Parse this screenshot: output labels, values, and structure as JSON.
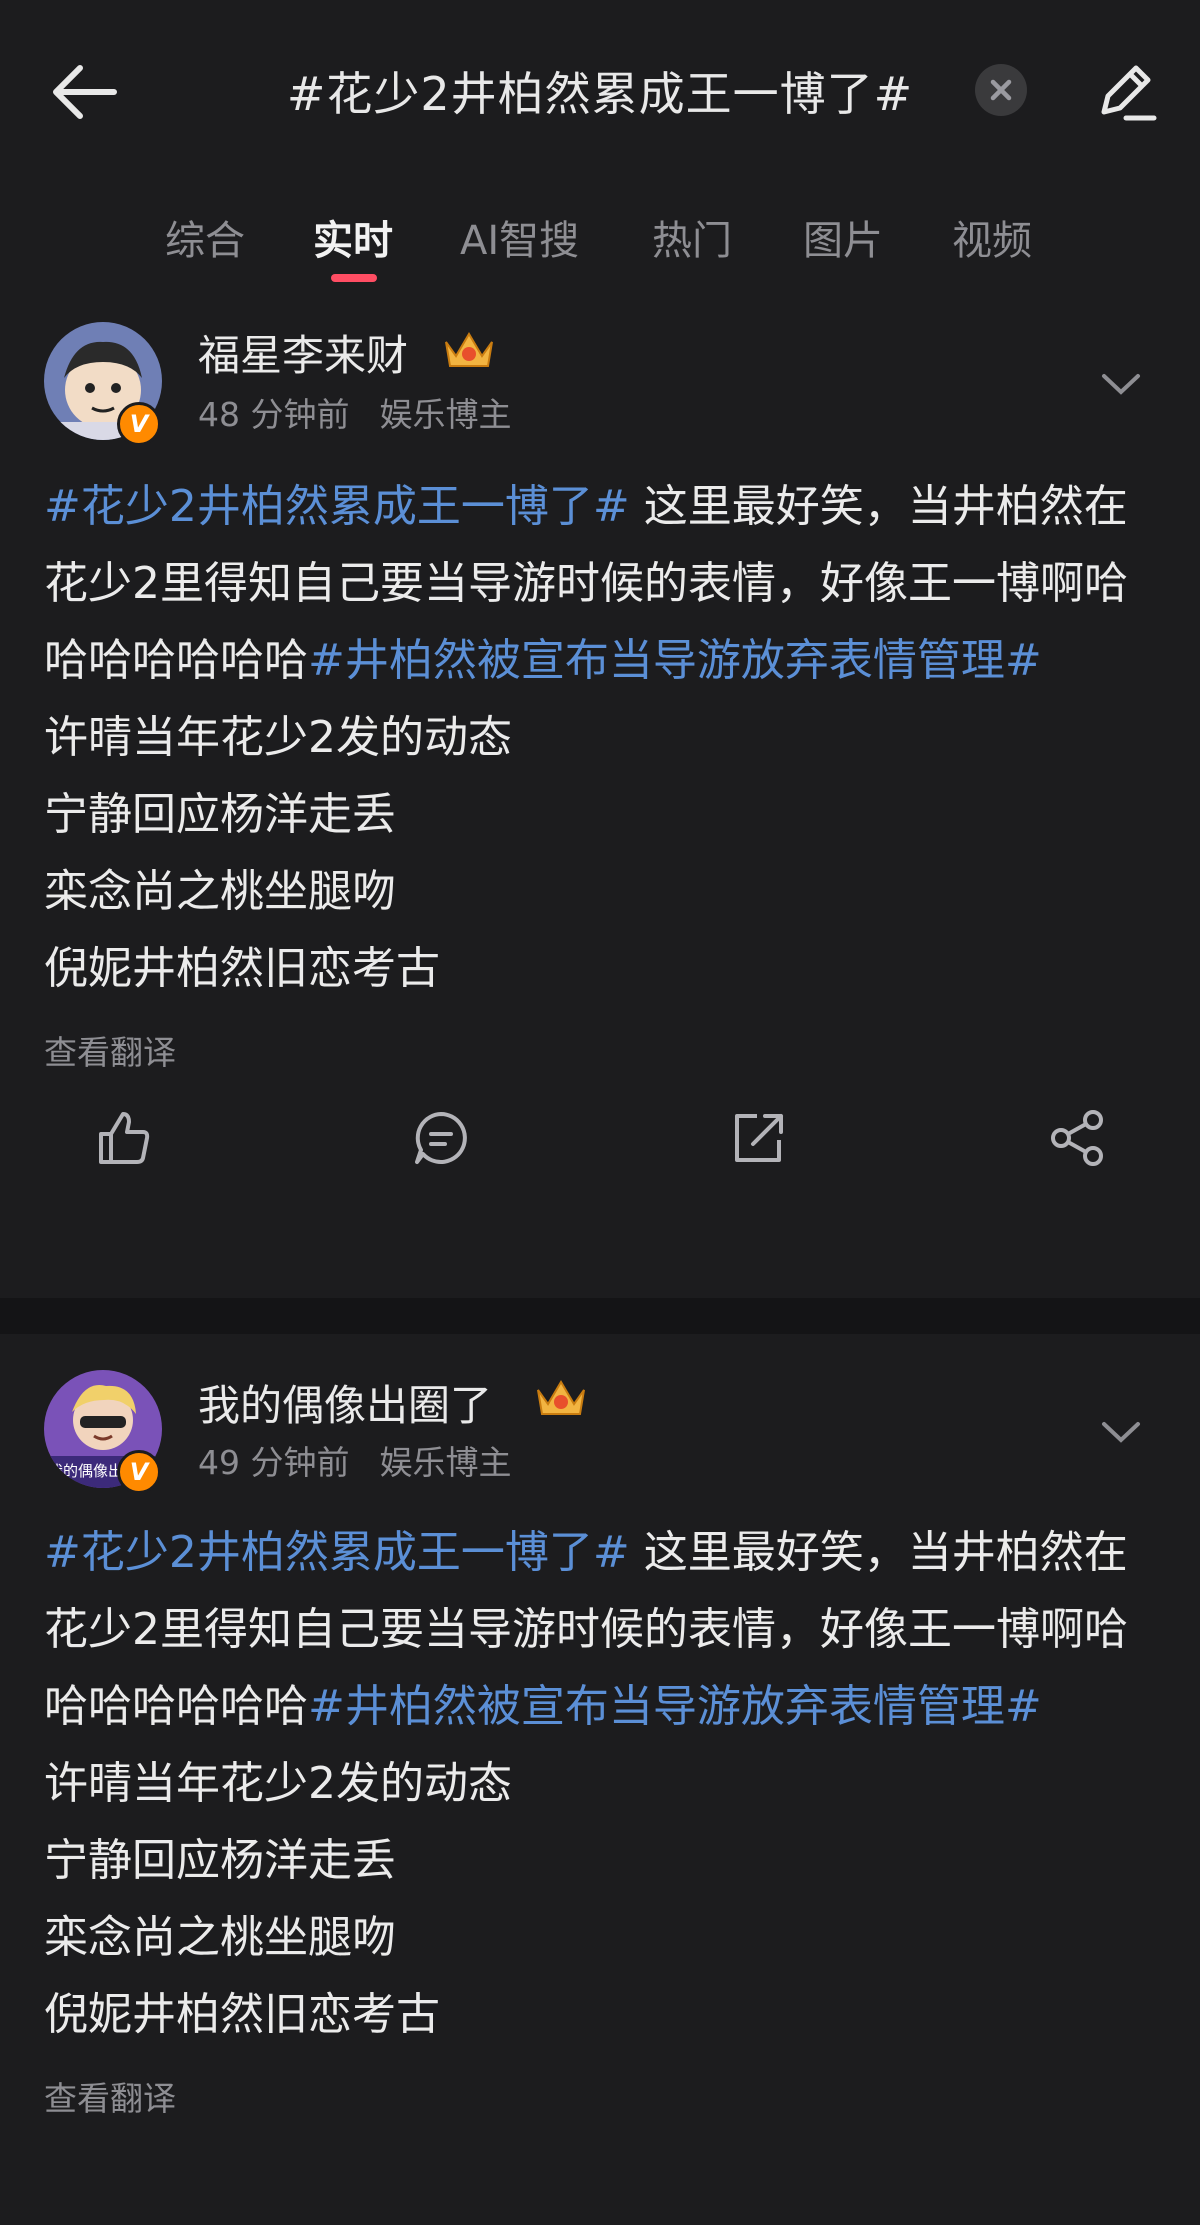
{
  "header": {
    "search_title": "#花少2井柏然累成王一博了#"
  },
  "tabs": [
    {
      "label": "综合"
    },
    {
      "label": "实时"
    },
    {
      "label": "AI智搜"
    },
    {
      "label": "热门"
    },
    {
      "label": "图片"
    },
    {
      "label": "视频"
    }
  ],
  "active_tab": "实时",
  "colors": {
    "background": "#1c1c1e",
    "hashtag": "#5b8fd6",
    "accent": "#ff4d63",
    "verified_badge": "#ff8a00"
  },
  "posts": [
    {
      "username": "福星李来财",
      "time": "48 分钟前",
      "tag": "娱乐博主",
      "badge": "V",
      "p1_hashtag": "#花少2井柏然累成王一博了#",
      "p1_text": " 这里最好笑，当井柏然在花少2里得知自己要当导游时候的表情，好像王一博啊哈哈哈哈哈哈哈",
      "p1_hashtag2": "#井柏然被宣布当导游放弃表情管理#",
      "lines": [
        "许晴当年花少2发的动态",
        "宁静回应杨洋走丢",
        "栾念尚之桃坐腿吻",
        "倪妮井柏然旧恋考古"
      ],
      "translate": "查看翻译"
    },
    {
      "username": "我的偶像出圈了",
      "time": "49 分钟前",
      "tag": "娱乐博主",
      "badge": "V",
      "avatar_text": "我的偶像出",
      "p1_hashtag": "#花少2井柏然累成王一博了#",
      "p1_text": " 这里最好笑，当井柏然在花少2里得知自己要当导游时候的表情，好像王一博啊哈哈哈哈哈哈哈",
      "p1_hashtag2": "#井柏然被宣布当导游放弃表情管理#",
      "lines": [
        "许晴当年花少2发的动态",
        "宁静回应杨洋走丢",
        "栾念尚之桃坐腿吻",
        "倪妮井柏然旧恋考古"
      ],
      "translate": "查看翻译"
    }
  ],
  "icons": [
    "back-arrow-icon",
    "clear-icon",
    "edit-icon",
    "crown-icon",
    "chevron-down-icon",
    "like-icon",
    "comment-icon",
    "repost-icon",
    "share-icon"
  ]
}
